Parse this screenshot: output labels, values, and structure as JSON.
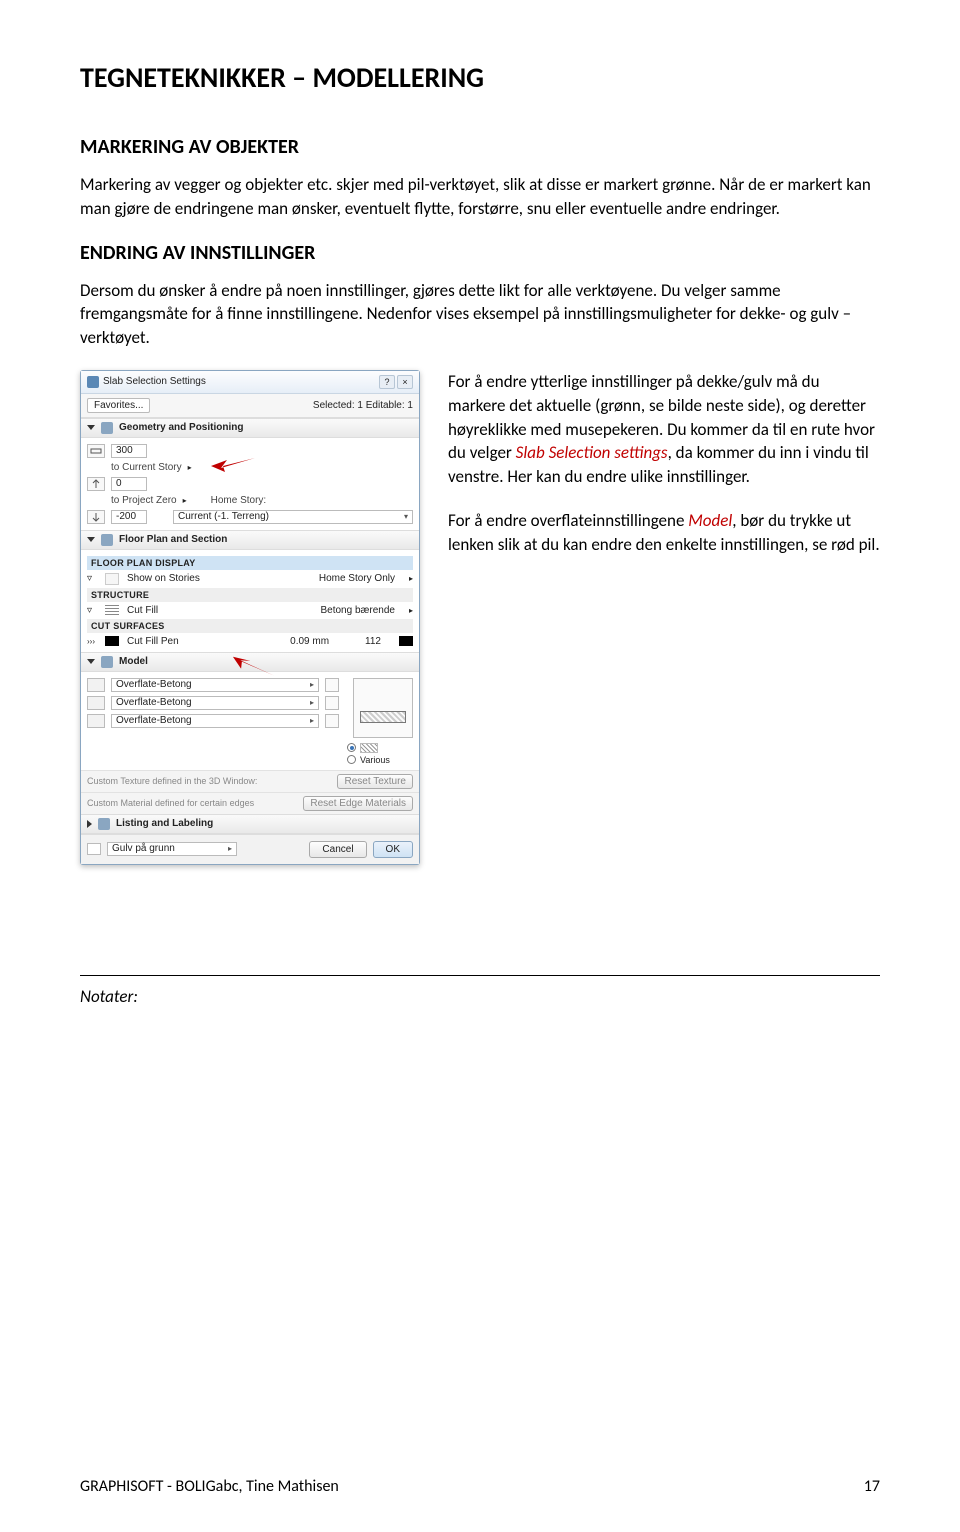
{
  "doc": {
    "title": "TEGNETEKNIKKER – MODELLERING",
    "h2a": "MARKERING AV OBJEKTER",
    "p1": "Markering av vegger og objekter etc. skjer med pil-verktøyet, slik at disse er markert grønne. Når de er markert kan man gjøre de endringene man ønsker, eventuelt flytte, forstørre, snu eller eventuelle andre endringer.",
    "h2b": "ENDRING AV INNSTILLINGER",
    "p2": "Dersom du ønsker å endre på noen innstillinger, gjøres dette likt for alle verktøyene. Du velger samme fremgangsmåte for å finne innstillingene. Nedenfor vises eksempel på innstillingsmuligheter for dekke- og gulv – verktøyet.",
    "side1a": "For å endre ytterlige innstillinger på dekke/gulv må du markere det aktuelle (grønn, se bilde neste side), og deretter høyreklikke med musepekeren. Du kommer da til en rute hvor du velger ",
    "side1b_red": "Slab Selection settings",
    "side1c": ", da kommer du inn i vindu til venstre. Her kan du endre ulike innstillinger.",
    "side2a": "For å endre overflateinnstillingene ",
    "side2b_red": "Model",
    "side2c": ", bør du trykke ut lenken slik at du kan endre den enkelte innstillingen, se rød pil.",
    "notes_label": "Notater:",
    "footer_left": "GRAPHISOFT - BOLIGabc, Tine Mathisen",
    "footer_right": "17"
  },
  "dialog": {
    "title": "Slab Selection Settings",
    "favorites": "Favorites...",
    "selected": "Selected: 1 Editable: 1",
    "sections": {
      "geom": "Geometry and Positioning",
      "floorplan": "Floor Plan and Section",
      "model": "Model",
      "listing": "Listing and Labeling"
    },
    "geom_rows": {
      "thickness": "300",
      "to_current": "to Current Story",
      "offset": "0",
      "to_project": "to Project Zero",
      "home_story_lbl": "Home Story:",
      "home_story_val": "Current (-1. Terreng)",
      "minus200": "-200"
    },
    "fps": {
      "display": "FLOOR PLAN DISPLAY",
      "show_on": "Show on Stories",
      "show_on_val": "Home Story Only",
      "structure": "STRUCTURE",
      "cut_fill": "Cut Fill",
      "cut_fill_val": "Betong bærende",
      "cut_surfaces": "CUT SURFACES",
      "cut_fill_pen": "Cut Fill Pen",
      "cut_fill_pen_w": "0.09 mm",
      "cut_fill_pen_n": "112"
    },
    "model_rows": {
      "surface": "Overflate-Betong",
      "various": "Various"
    },
    "footnotes": {
      "tex": "Custom Texture defined in the 3D Window:",
      "mat": "Custom Material defined for certain edges",
      "reset_tex": "Reset Texture",
      "reset_mat": "Reset Edge Materials"
    },
    "bottom": {
      "layer": "Gulv på grunn",
      "cancel": "Cancel",
      "ok": "OK"
    }
  }
}
